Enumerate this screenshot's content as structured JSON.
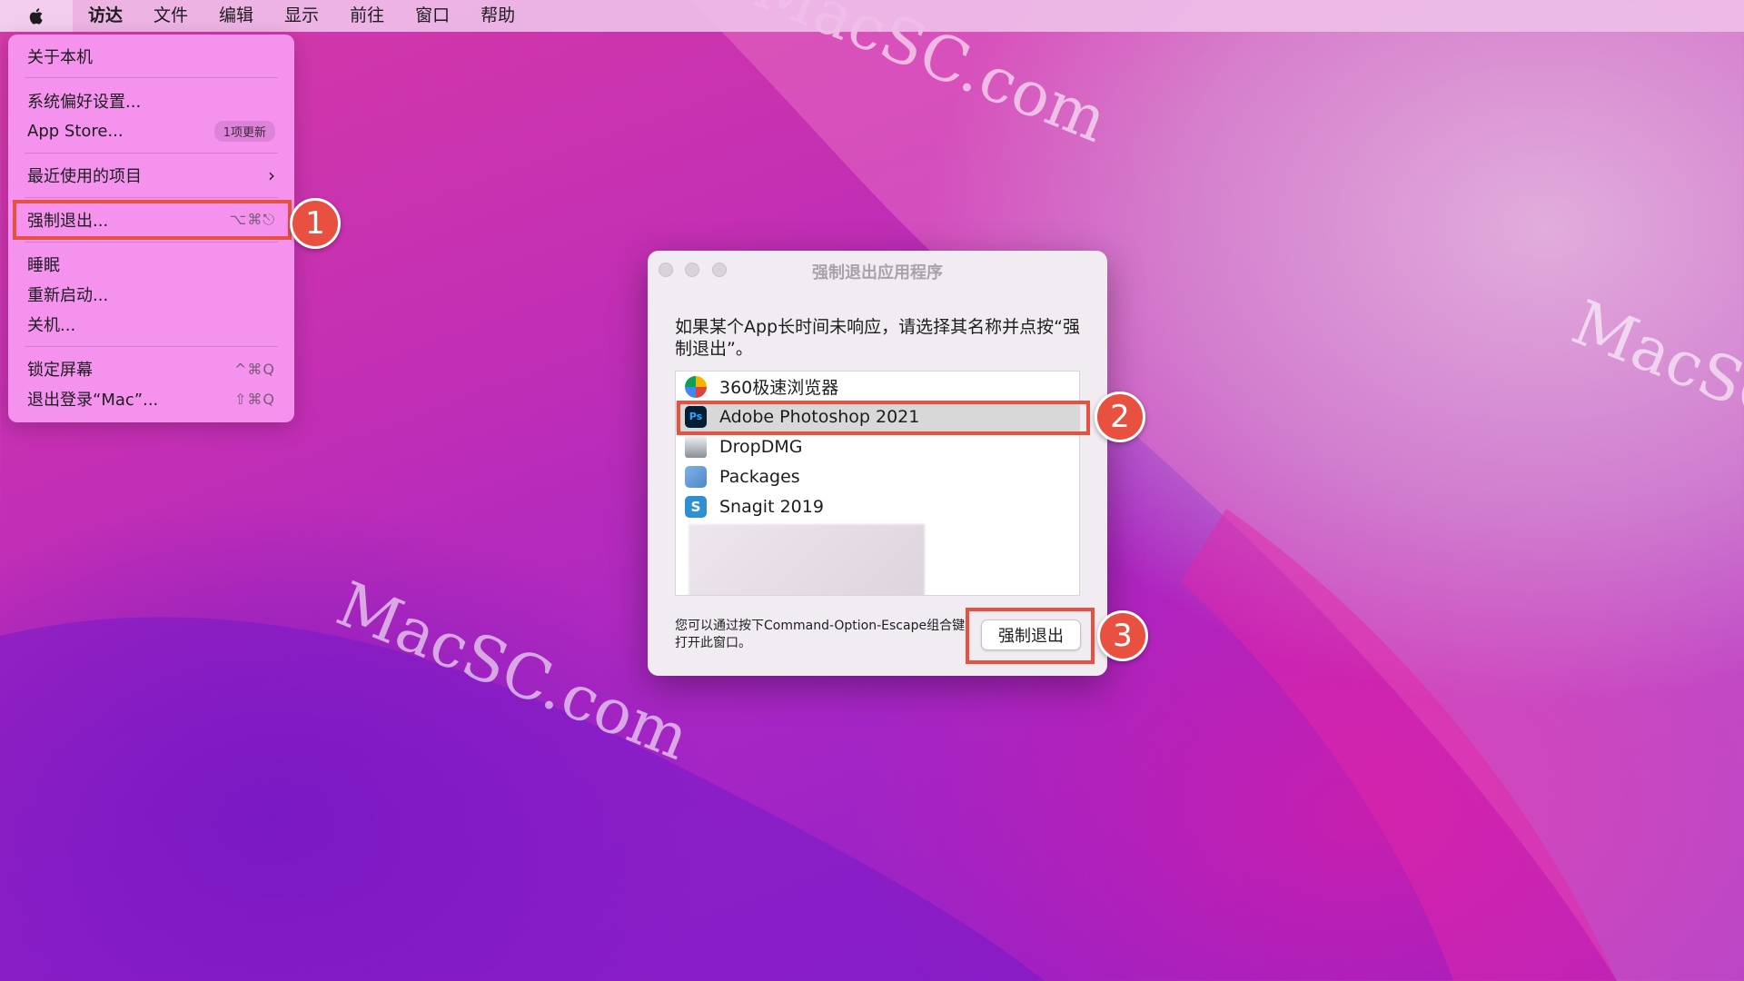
{
  "menubar": {
    "items": [
      "访达",
      "文件",
      "编辑",
      "显示",
      "前往",
      "窗口",
      "帮助"
    ]
  },
  "apple_menu": {
    "about": "关于本机",
    "prefs": "系统偏好设置...",
    "app_store": "App Store...",
    "app_store_badge": "1项更新",
    "recent": "最近使用的项目",
    "force_quit": "强制退出...",
    "force_quit_shortcut": "⌥⌘⎋",
    "sleep": "睡眠",
    "restart": "重新启动...",
    "shutdown": "关机...",
    "lock": "锁定屏幕",
    "lock_shortcut": "^⌘Q",
    "logout": "退出登录“Mac”...",
    "logout_shortcut": "⇧⌘Q"
  },
  "steps": [
    "1",
    "2",
    "3"
  ],
  "dialog": {
    "title": "强制退出应用程序",
    "prompt": "如果某个App长时间未响应，请选择其名称并点按“强制退出”。",
    "apps": [
      {
        "name": "360极速浏览器",
        "icon": "360-browser-icon",
        "color": "#3aa8e0"
      },
      {
        "name": "Adobe Photoshop 2021",
        "icon": "photoshop-icon",
        "color": "#001e36"
      },
      {
        "name": "DropDMG",
        "icon": "dropdmg-icon",
        "color": "#8a8f98"
      },
      {
        "name": "Packages",
        "icon": "packages-icon",
        "color": "#4e86c9"
      },
      {
        "name": "Snagit 2019",
        "icon": "snagit-icon",
        "color": "#2f8fd0"
      }
    ],
    "footer": "您可以通过按下Command-Option-Escape组合键打开此窗口。",
    "button": "强制退出"
  },
  "watermark": "MacSC.com",
  "colors": {
    "highlight": "#e8503f"
  }
}
